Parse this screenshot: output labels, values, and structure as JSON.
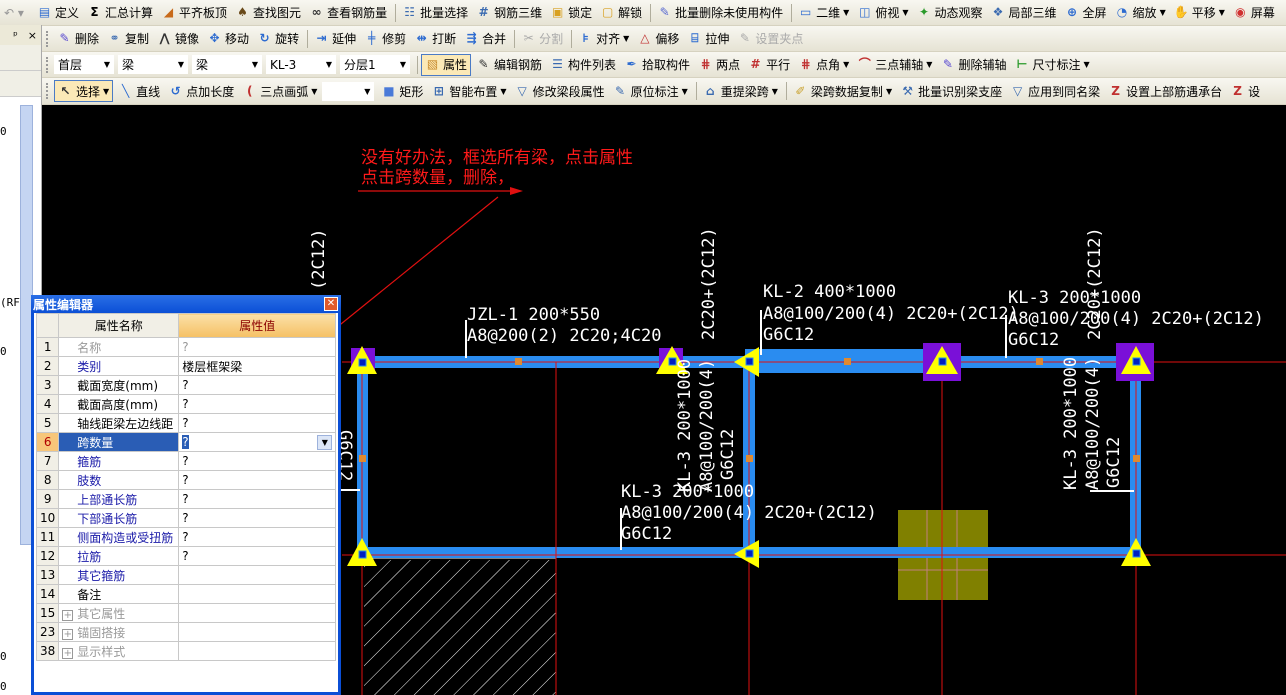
{
  "toolbar1": {
    "items": [
      {
        "label": "定义",
        "icon": "define-icon",
        "g": "▤",
        "c": "#2d6bd0"
      },
      {
        "label": "汇总计算",
        "icon": "sigma-icon",
        "g": "Σ",
        "c": "#000"
      },
      {
        "label": "平齐板顶",
        "icon": "align-slab-top-icon",
        "g": "◢",
        "c": "#c86a1a"
      },
      {
        "label": "查找图元",
        "icon": "binoculars-icon",
        "g": "♠",
        "c": "#6a4a1a"
      },
      {
        "label": "查看钢筋量",
        "icon": "glasses-icon",
        "g": "∞",
        "c": "#333"
      },
      {
        "label": "批量选择",
        "icon": "batch-select-icon",
        "g": "☷",
        "c": "#3a6ab0"
      },
      {
        "label": "钢筋三维",
        "icon": "rebar-3d-icon",
        "g": "#",
        "c": "#3a6ab0"
      },
      {
        "label": "锁定",
        "icon": "lock-icon",
        "g": "▣",
        "c": "#d8a020"
      },
      {
        "label": "解锁",
        "icon": "unlock-icon",
        "g": "▢",
        "c": "#d8a020"
      },
      {
        "label": "批量删除未使用构件",
        "icon": "batch-delete-icon",
        "g": "✎",
        "c": "#5a6ad0"
      },
      {
        "label": "二维",
        "icon": "2d-view-icon",
        "g": "▭",
        "c": "#2d6bd0",
        "dd": true
      },
      {
        "label": "俯视",
        "icon": "top-view-icon",
        "g": "◫",
        "c": "#2d6bd0",
        "dd": true
      },
      {
        "label": "动态观察",
        "icon": "orbit-icon",
        "g": "✦",
        "c": "#2a9a2a"
      },
      {
        "label": "局部三维",
        "icon": "local-3d-icon",
        "g": "❖",
        "c": "#3a6ab0"
      },
      {
        "label": "全屏",
        "icon": "fullscreen-icon",
        "g": "⊕",
        "c": "#2d6bd0"
      },
      {
        "label": "缩放",
        "icon": "zoom-icon",
        "g": "◔",
        "c": "#2d6bd0",
        "dd": true
      },
      {
        "label": "平移",
        "icon": "pan-hand-icon",
        "g": "✋",
        "c": "#c88a2a",
        "dd": true
      },
      {
        "label": "屏幕",
        "icon": "screen-icon",
        "g": "◉",
        "c": "#d03030"
      }
    ]
  },
  "toolbar2": {
    "items": [
      {
        "label": "删除",
        "icon": "delete-icon",
        "g": "✎",
        "c": "#5a4ad0"
      },
      {
        "label": "复制",
        "icon": "copy-icon",
        "g": "⚭",
        "c": "#3a6ab0"
      },
      {
        "label": "镜像",
        "icon": "mirror-icon",
        "g": "⋀",
        "c": "#333"
      },
      {
        "label": "移动",
        "icon": "move-icon",
        "g": "✥",
        "c": "#2d6bd0"
      },
      {
        "label": "旋转",
        "icon": "rotate-icon",
        "g": "↻",
        "c": "#2d6bd0"
      },
      {
        "label": "延伸",
        "icon": "extend-icon",
        "g": "⇥",
        "c": "#2d6bd0"
      },
      {
        "label": "修剪",
        "icon": "trim-icon",
        "g": "╪",
        "c": "#2d6bd0"
      },
      {
        "label": "打断",
        "icon": "break-icon",
        "g": "⇹",
        "c": "#2d6bd0"
      },
      {
        "label": "合并",
        "icon": "merge-icon",
        "g": "⇶",
        "c": "#2d6bd0"
      },
      {
        "label": "分割",
        "icon": "split-icon",
        "g": "✂",
        "c": "#aaa",
        "disabled": true
      },
      {
        "label": "对齐",
        "icon": "align-icon",
        "g": "⊧",
        "c": "#2d6bd0",
        "dd": true
      },
      {
        "label": "偏移",
        "icon": "offset-icon",
        "g": "△",
        "c": "#c03030"
      },
      {
        "label": "拉伸",
        "icon": "stretch-icon",
        "g": "⌸",
        "c": "#2d6bd0"
      },
      {
        "label": "设置夹点",
        "icon": "grip-point-icon",
        "g": "✎",
        "c": "#aaa",
        "disabled": true
      }
    ]
  },
  "toolbar3": {
    "selects": [
      {
        "name": "floor-select",
        "value": "首层",
        "w": 60
      },
      {
        "name": "category-select",
        "value": "梁",
        "w": 70
      },
      {
        "name": "type-select",
        "value": "梁",
        "w": 70
      },
      {
        "name": "component-select",
        "value": "KL-3",
        "w": 70
      },
      {
        "name": "sublayer-select",
        "value": "分层1",
        "w": 70
      }
    ],
    "items": [
      {
        "label": "属性",
        "icon": "properties-icon",
        "g": "▧",
        "c": "#c88a2a",
        "pressed": true
      },
      {
        "label": "编辑钢筋",
        "icon": "edit-rebar-icon",
        "g": "✎",
        "c": "#333"
      },
      {
        "label": "构件列表",
        "icon": "component-list-icon",
        "g": "☰",
        "c": "#3a6ab0"
      },
      {
        "label": "拾取构件",
        "icon": "pick-component-icon",
        "g": "✒",
        "c": "#2d6bd0"
      },
      {
        "label": "两点",
        "icon": "two-point-axis-icon",
        "g": "⋕",
        "c": "#c03030"
      },
      {
        "label": "平行",
        "icon": "parallel-axis-icon",
        "g": "#",
        "c": "#c03030"
      },
      {
        "label": "点角",
        "icon": "point-angle-axis-icon",
        "g": "⋕",
        "c": "#c03030",
        "dd": true
      },
      {
        "label": "三点辅轴",
        "icon": "three-point-axis-icon",
        "g": "⌒",
        "c": "#c03030",
        "dd": true
      },
      {
        "label": "删除辅轴",
        "icon": "delete-axis-icon",
        "g": "✎",
        "c": "#5a4ad0"
      },
      {
        "label": "尺寸标注",
        "icon": "dimension-icon",
        "g": "⊢",
        "c": "#2a9a2a",
        "dd": true
      }
    ]
  },
  "toolbar4": {
    "items": [
      {
        "label": "选择",
        "icon": "cursor-icon",
        "g": "↖",
        "c": "#333",
        "pressed": true,
        "dd": true
      },
      {
        "label": "直线",
        "icon": "line-icon",
        "g": "╲",
        "c": "#2d6bd0"
      },
      {
        "label": "点加长度",
        "icon": "point-length-icon",
        "g": "↺",
        "c": "#2d6bd0"
      },
      {
        "label": "三点画弧",
        "icon": "arc-icon",
        "g": "(",
        "c": "#c03030",
        "dd": true
      },
      {
        "select": true,
        "value": ""
      },
      {
        "label": "矩形",
        "icon": "rectangle-icon",
        "g": "■",
        "c": "#4a7ad8"
      },
      {
        "label": "智能布置",
        "icon": "smart-layout-icon",
        "g": "⊞",
        "c": "#3a6ab0",
        "dd": true
      },
      {
        "label": "修改梁段属性",
        "icon": "modify-span-icon",
        "g": "▽",
        "c": "#3a6ab0"
      },
      {
        "label": "原位标注",
        "icon": "in-situ-label-icon",
        "g": "✎",
        "c": "#3a6ab0",
        "dd": true
      },
      {
        "label": "重提梁跨",
        "icon": "re-extract-span-icon",
        "g": "⌂",
        "c": "#3a6ab0",
        "dd": true
      },
      {
        "label": "梁跨数据复制",
        "icon": "copy-span-data-icon",
        "g": "✐",
        "c": "#c8a02a",
        "dd": true
      },
      {
        "label": "批量识别梁支座",
        "icon": "identify-support-icon",
        "g": "⚒",
        "c": "#3a6ab0"
      },
      {
        "label": "应用到同名梁",
        "icon": "apply-same-name-icon",
        "g": "▽",
        "c": "#3a6ab0"
      },
      {
        "label": "设置上部筋遇承台",
        "icon": "set-top-rebar-icon",
        "g": "Z",
        "c": "#c03030"
      },
      {
        "label": "设",
        "icon": "set-icon",
        "g": "Z",
        "c": "#c03030"
      }
    ]
  },
  "left_panel": {
    "pin": "ᵖ",
    "close": "×",
    "fragments": [
      "0",
      "(RF",
      "0",
      "0",
      "0"
    ]
  },
  "canvas": {
    "note_line1": "没有好办法，框选所有梁，点击属性",
    "note_line2": "点击跨数量，删除，",
    "labels": {
      "jzl1_a": "JZL-1 200*550",
      "jzl1_b": "A8@200(2) 2C20;4C20",
      "kl2_a": "KL-2 400*1000",
      "kl2_b": "A8@100/200(4)  2C20+(2C12)",
      "kl2_c": "G6C12",
      "kl3r_a": "KL-3 200*1000",
      "kl3r_b": "A8@100/200(4)  2C20+(2C12)",
      "kl3r_c": "G6C12",
      "kl3b_a": "KL-3 200*1000",
      "kl3b_b": "A8@100/200(4)  2C20+(2C12)",
      "kl3b_c": "G6C12",
      "v_left_top": "(2C12)",
      "v_left_mid": "G6C12",
      "v_mid_top": "2C20+(2C12)",
      "v_mid_a": "KL-3 200*1000",
      "v_mid_b": "A8@100/200(4)",
      "v_mid_c": "G6C12",
      "v_right_top": "2C20+(2C12)",
      "v_right_a": "KL-3 200*1000",
      "v_right_b": "A8@100/200(4)",
      "v_right_c": "G6C12"
    },
    "colors": {
      "beam": "#2a8cf0",
      "axis": "#e01010",
      "node": "#ffff00",
      "column": "#7a10d8",
      "footing": "#808000",
      "annotation": "#ff1a1a"
    }
  },
  "property_editor": {
    "title": "属性编辑器",
    "col_name": "属性名称",
    "col_value": "属性值",
    "rows": [
      {
        "idx": "1",
        "name": "名称",
        "value": "?",
        "style": "gray"
      },
      {
        "idx": "2",
        "name": "类别",
        "value": "楼层框架梁",
        "style": "blue"
      },
      {
        "idx": "3",
        "name": "截面宽度(mm)",
        "value": "?",
        "style": "black"
      },
      {
        "idx": "4",
        "name": "截面高度(mm)",
        "value": "?",
        "style": "black"
      },
      {
        "idx": "5",
        "name": "轴线距梁左边线距",
        "value": "?",
        "style": "black"
      },
      {
        "idx": "6",
        "name": "跨数量",
        "value": "?",
        "style": "blue",
        "selected": true
      },
      {
        "idx": "7",
        "name": "箍筋",
        "value": "?",
        "style": "blue"
      },
      {
        "idx": "8",
        "name": "肢数",
        "value": "?",
        "style": "blue"
      },
      {
        "idx": "9",
        "name": "上部通长筋",
        "value": "?",
        "style": "blue"
      },
      {
        "idx": "10",
        "name": "下部通长筋",
        "value": "?",
        "style": "blue"
      },
      {
        "idx": "11",
        "name": "侧面构造或受扭筋",
        "value": "?",
        "style": "blue"
      },
      {
        "idx": "12",
        "name": "拉筋",
        "value": "?",
        "style": "blue"
      },
      {
        "idx": "13",
        "name": "其它箍筋",
        "value": "",
        "style": "blue"
      },
      {
        "idx": "14",
        "name": "备注",
        "value": "",
        "style": "black"
      },
      {
        "idx": "15",
        "name": "其它属性",
        "value": "",
        "style": "gray",
        "group": true
      },
      {
        "idx": "23",
        "name": "锚固搭接",
        "value": "",
        "style": "gray",
        "group": true
      },
      {
        "idx": "38",
        "name": "显示样式",
        "value": "",
        "style": "gray",
        "group": true
      }
    ]
  }
}
